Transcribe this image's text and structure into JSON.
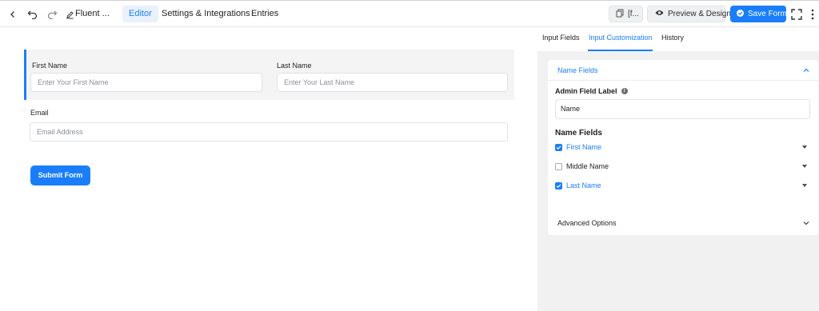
{
  "topbar": {
    "form_name": "Fluent ...",
    "tabs": [
      "Editor",
      "Settings & Integrations",
      "Entries"
    ],
    "copy_label": "[f...",
    "preview_label": "Preview & Design",
    "save_label": "Save Form"
  },
  "form": {
    "first_name": {
      "label": "First Name",
      "placeholder": "Enter Your First Name"
    },
    "last_name": {
      "label": "Last Name",
      "placeholder": "Enter Your Last Name"
    },
    "email": {
      "label": "Email",
      "placeholder": "Email Address"
    },
    "submit_label": "Submit Form"
  },
  "sidebar": {
    "tabs": [
      "Input Fields",
      "Input Customization",
      "History"
    ],
    "active_tab": "Input Customization",
    "section_title": "Name Fields",
    "admin_label_title": "Admin Field Label",
    "admin_label_value": "Name",
    "name_fields_title": "Name Fields",
    "name_fields": [
      {
        "label": "First Name",
        "checked": true
      },
      {
        "label": "Middle Name",
        "checked": false
      },
      {
        "label": "Last Name",
        "checked": true
      }
    ],
    "advanced_title": "Advanced Options"
  },
  "colors": {
    "accent": "#1a7efb",
    "panel_bg": "#f1f1f1",
    "block_bg": "#f4f4f5"
  }
}
